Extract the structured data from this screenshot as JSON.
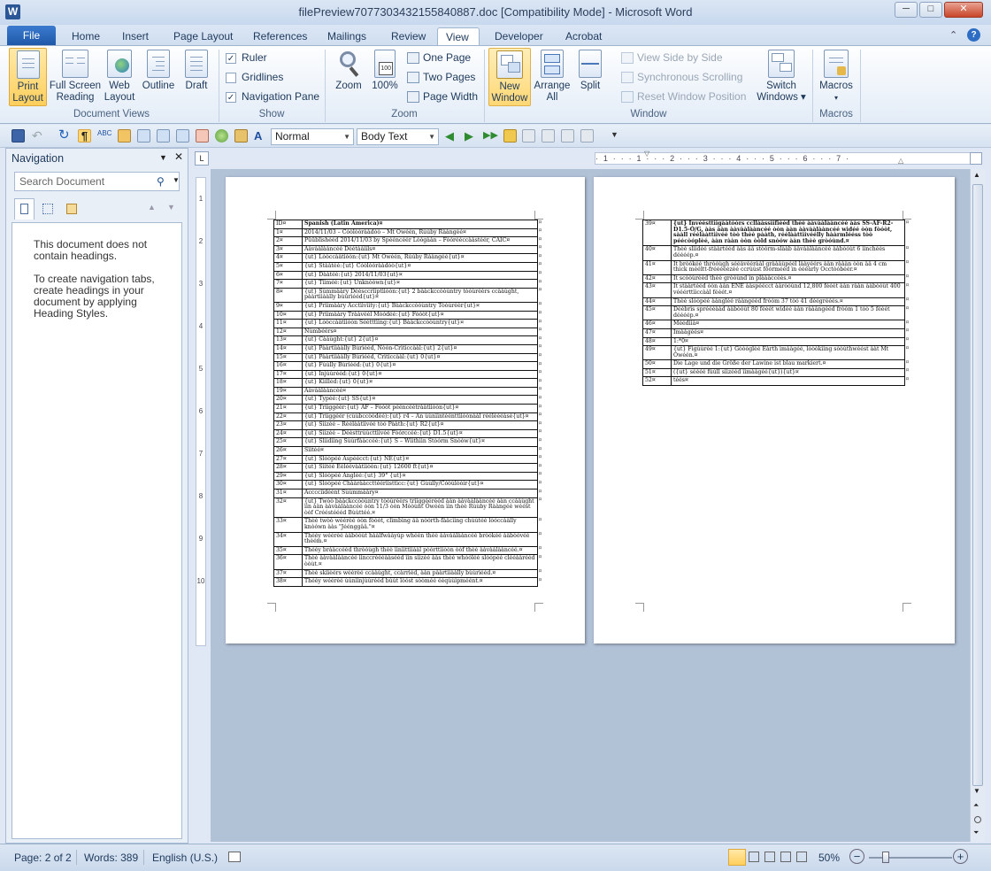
{
  "window": {
    "title": "filePreview7077303432155840887.doc [Compatibility Mode] - Microsoft Word",
    "minimize": "─",
    "maximize": "□",
    "close": "✕"
  },
  "tabs": {
    "file": "File",
    "items": [
      "Home",
      "Insert",
      "Page Layout",
      "References",
      "Mailings",
      "Review",
      "View",
      "Developer",
      "Acrobat"
    ],
    "active": "View"
  },
  "ribbon": {
    "document_views": {
      "label": "Document Views",
      "buttons": [
        {
          "line1": "Print",
          "line2": "Layout"
        },
        {
          "line1": "Full Screen",
          "line2": "Reading"
        },
        {
          "line1": "Web",
          "line2": "Layout"
        },
        {
          "line1": "Outline",
          "line2": ""
        },
        {
          "line1": "Draft",
          "line2": ""
        }
      ]
    },
    "show": {
      "label": "Show",
      "ruler": "Ruler",
      "gridlines": "Gridlines",
      "navigation_pane": "Navigation Pane",
      "ruler_checked": true,
      "gridlines_checked": false,
      "navigation_checked": true
    },
    "zoom": {
      "label": "Zoom",
      "zoom": "Zoom",
      "hundred": "100%",
      "one_page": "One Page",
      "two_pages": "Two Pages",
      "page_width": "Page Width"
    },
    "window": {
      "label": "Window",
      "new_window_1": "New",
      "new_window_2": "Window",
      "arrange_1": "Arrange",
      "arrange_2": "All",
      "split": "Split",
      "view_side": "View Side by Side",
      "sync_scroll": "Synchronous Scrolling",
      "reset_pos": "Reset Window Position",
      "switch_1": "Switch",
      "switch_2": "Windows ▾"
    },
    "macros": {
      "label": "Macros",
      "button": "Macros"
    }
  },
  "qat": {
    "style_value": "Normal",
    "font_style_value": "Body Text"
  },
  "navigation": {
    "title": "Navigation",
    "search_placeholder": "Search Document",
    "message1": "This document does not contain headings.",
    "message2": "To create navigation tabs, create headings in your document by applying Heading Styles."
  },
  "page1_rows": [
    [
      "ID¤",
      "Spanish (Latin America)¤"
    ],
    [
      "1¤",
      "2014/11/03 – Cóòlòòrààdòò – Mt Ówéén, Rúúby Rààngéé¤"
    ],
    [
      "2¤",
      "Püüblìshééd 2014/11/03 by Spééncéér Lòógààn – Fòórééccààstéér, CAIC¤"
    ],
    [
      "3¤",
      "Ààvààlààncéé Déétààììls¤"
    ],
    [
      "4¤",
      "{ut} Lòòccààtìòòn:{ut} Mt Ówéén, Rúúby Rààngéé{ut}¤"
    ],
    [
      "5¤",
      "{ut} Stààtéé:{ut} Cóòlòòrààdòò{ut}¤"
    ],
    [
      "6¤",
      "{ut} Dààtéé:{ut} 2014/11/03{ut}¤"
    ],
    [
      "7¤",
      "{ut} Tììméé:{ut} Ùnknòòwn{ut}¤"
    ],
    [
      "8¤",
      "{ut} Sùmmààry Déésccrììptììòòn:{ut} 2 bààckccòòùntry tòòùrèèrs ccààùght, pààrtììààlly bùùrìééd{ut}¤"
    ],
    [
      "9¤",
      "{ut} Prììmààry Acctììvììty:{ut} Bààckccòòùntry Tòòùrèèr{ut}¤"
    ],
    [
      "10¤",
      "{ut} Prììmààry Trààvéél Mòódéé:{ut} Fòóòt{ut}¤"
    ],
    [
      "11¤",
      "{ut} Lòòccààtììòòn Séétttììng:{ut} Bààckccòòùntry{ut}¤"
    ],
    [
      "12¤",
      "Nùmbéérs¤"
    ],
    [
      "13¤",
      "{ut} Cààùght:{ut} 2{ut}¤"
    ],
    [
      "14¤",
      "{ut} Pààrtììààlly Bùrìééd, Nòòn-Crìtìccààl:{ut} 2{ut}¤"
    ],
    [
      "15¤",
      "{ut} Pààrtììààlly Bùrìééd, Crìtìccààl:{ut} 0{ut}¤"
    ],
    [
      "16¤",
      "{ut} Fùùlly Bùrìééd:{ut} 0{ut}¤"
    ],
    [
      "17¤",
      "{ut} Ìnjùùrééd:{ut} 0{ut}¤"
    ],
    [
      "18¤",
      "{ut} Kììlléd:{ut} 0{ut}¤"
    ],
    [
      "19¤",
      "Ààvààlààncéé¤"
    ],
    [
      "20¤",
      "{ut} Typéé:{ut} SS{ut}¤"
    ],
    [
      "21¤",
      "{ut} Trììggéér:{ut} AF – Fòóòt pééncéétrààtììòòn{ut}¤"
    ],
    [
      "22¤",
      "{ut} Trììggéér (cùùbccòòdéé):{ut} r4 – An ùùnììntéénttììòònààl rééléééàsé{ut}¤"
    ],
    [
      "23¤",
      "{ut} Sììzéé – Réélààtììvéé tòó Pààth:{ut} R2{ut}¤"
    ],
    [
      "24¤",
      "{ut} Sììzéé – Déésttrùùcttììvéé Fòórccéé:{ut} D1.5{ut}¤"
    ],
    [
      "25¤",
      "{ut} Slììdììng Sùùrfààccéé:{ut} S – Wììthììn Stòórm Snòów{ut}¤"
    ],
    [
      "26¤",
      "Sììtéé¤"
    ],
    [
      "27¤",
      "{ut} Slòòpéé Aspéécct:{ut} NE{ut}¤"
    ],
    [
      "28¤",
      "{ut} Sììtéé Ééléévààtììòòn:{ut} 12600 ft{ut}¤"
    ],
    [
      "29¤",
      "{ut} Slòòpéé Ànglèé:{ut} 39° {ut}¤"
    ],
    [
      "30¤",
      "{ut} Slòòpéé Chààrààccttéérììsttìcc:{ut} Gùùlly/Cóòùlòòir{ut}¤"
    ],
    [
      "31¤",
      "Accccììdéént Sùùmmààry¤"
    ],
    [
      "32¤",
      "{ut} Twòò bààckccòòùntry tòòùrèèrs trììggéérééd ààn ààvààlààncéé ààn ccààùght ììn ààn ààvààlààncéé òòn 11/3 òòn Mòòùnt Ówéén ììn thèè Rùùby Rààngéé wéést òòf Crééstéééd Bùùttéé.¤"
    ],
    [
      "33¤",
      "Thèè twòò wéérèé òòn fòóòt, clìmbìng ââ nòórth-fââcììng chùùtéé lòóccààlly knòówn ààs \"Jéénggââ.\"¤"
    ],
    [
      "34¤",
      "Thééy wéérèé ààbòóùt hààlfwààyùp whéén thèè ààvààlààncéé bròókèé ààbòóvéé thèém.¤"
    ],
    [
      "35¤",
      "Thééy brààccééd thròóùgh thèè ììnììttììààl pòórttììòòn òòf thèè ààvààlààncéé.¤"
    ],
    [
      "36¤",
      "Thèè ààvààlààncéé ììnccréééààsééd ììn sììzéé ààs thèè whòóléé slòópéé clééààrééd òòùt.¤"
    ],
    [
      "37¤",
      "Thèè skììèérs wéérèé ccààùght, ccàrrìéd, ààn pààrtììààlly bùùrìééd.¤"
    ],
    [
      "38¤",
      "Thééy wéérèé ùùnììnjùùrééd bùùt lòóst sòòméé ééqùùìpméént.¤"
    ]
  ],
  "page2_rows": [
    [
      "39¤",
      "{ut} Ìnvéésttììgààtòórs ccllààssììfìééd thèè ààvààlààncéé ààs SS-AF-R2-D1.5-Ó/G, ààs ààn ààvààlààncéé òòn ààn ààvààlààncéé wìdéé òòn fòóòt, sààll réélààttììvéé tòò thèè pààth, réélààttììvéélly hààrmlééss tòò péécòóplèé, ààn rààn òòn òòld snòów ààn thèè gròóùnd.¤"
    ],
    [
      "40¤",
      "Thèè slììdéé stààrtééd ààs ââ stòórm-slààb ààvààlààncéé ààbòóùt 6 ììnchéés déééép.¤"
    ],
    [
      "41¤",
      "Ìt bròókéé thròóùgh sééàvéérààl gràààùpéél lààyéérs ààn ràààn òòn ââ 4 cm thìck mééltt-frééééézéé ccrùùst fòórmééd ìn éééàrly Occtòóbéér.¤"
    ],
    [
      "42¤",
      "Ìt scòòùrééd thèè gròóùnd ìn plàààccéés.¤"
    ],
    [
      "43¤",
      "Ìt stààrtééd òòn ààn ÉNÉ ààspéécct ààròóùnd 12,800 fééét ààn rààn ààbòóùt 400 vééérttììccààl fééét.¤"
    ],
    [
      "44¤",
      "Thèè slòòpéé ààngléé rààngééd fròóm 37 tòó 41 déégrééés.¤"
    ],
    [
      "45¤",
      "Déébrìs spréééààd ààbòóùt 80 fééét wìdéé ààn ràààngééd fròóm 1 tòò 5 fééét déééép.¤"
    ],
    [
      "46¤",
      "Méédììà¤"
    ],
    [
      "47¤",
      "Ìmààgéés¤"
    ],
    [
      "48¤",
      "1:*0¤"
    ],
    [
      "49¤",
      "{ut} Fìgùùrèé 1:{ut} Gòòòglèé Éàrth ìmààgéé, lòòòkììng sòòùthwéést ààt Mt Ówéén.¤"
    ],
    [
      "50¤",
      "Die Lage und die Größe der Lawine ist blau markiert.¤"
    ],
    [
      "51¤",
      "({ut} séééé fùùll sììzééd ììmààgéé{ut}){ut}¤"
    ],
    [
      "52¤",
      "téés¤"
    ]
  ],
  "status": {
    "page": "Page: 2 of 2",
    "words": "Words: 389",
    "language": "English (U.S.)",
    "zoom": "50%"
  }
}
